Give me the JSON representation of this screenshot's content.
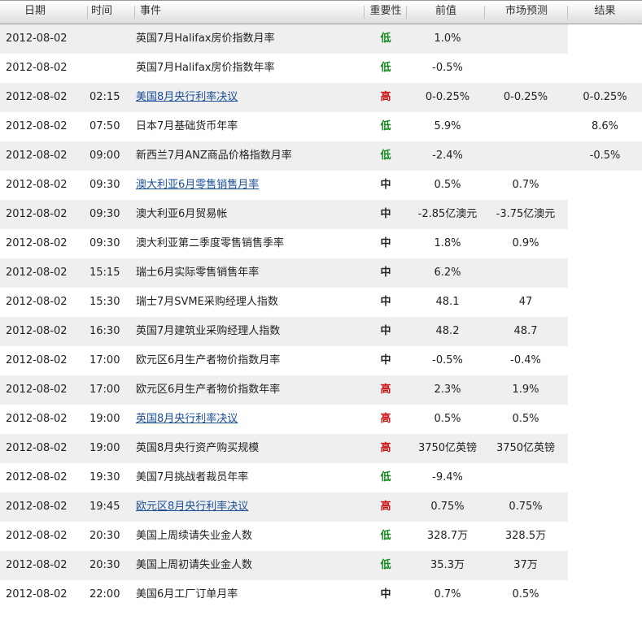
{
  "header": {
    "date": "日期",
    "time": "时间",
    "event": "事件",
    "importance": "重要性",
    "previous": "前值",
    "forecast": "市场预测",
    "result": "结果"
  },
  "colors": {
    "low": "#13881f",
    "medium": "#1a22b0",
    "high": "#d01010",
    "link": "#1a4f99"
  },
  "rows": [
    {
      "date": "2012-08-02",
      "time": "",
      "event": "英国7月Halifax房价指数月率",
      "link": false,
      "importance": "低",
      "level": "low",
      "previous": "1.0%",
      "forecast": "",
      "result": ""
    },
    {
      "date": "2012-08-02",
      "time": "",
      "event": "英国7月Halifax房价指数年率",
      "link": false,
      "importance": "低",
      "level": "low",
      "previous": "-0.5%",
      "forecast": "",
      "result": ""
    },
    {
      "date": "2012-08-02",
      "time": "02:15",
      "event": "美国8月央行利率决议",
      "link": true,
      "importance": "高",
      "level": "high",
      "previous": "0-0.25%",
      "forecast": "0-0.25%",
      "result": "0-0.25%"
    },
    {
      "date": "2012-08-02",
      "time": "07:50",
      "event": "日本7月基础货币年率",
      "link": false,
      "importance": "低",
      "level": "low",
      "previous": "5.9%",
      "forecast": "",
      "result": "8.6%"
    },
    {
      "date": "2012-08-02",
      "time": "09:00",
      "event": "新西兰7月ANZ商品价格指数月率",
      "link": false,
      "importance": "低",
      "level": "low",
      "previous": "-2.4%",
      "forecast": "",
      "result": "-0.5%"
    },
    {
      "date": "2012-08-02",
      "time": "09:30",
      "event": "澳大利亚6月零售销售月率",
      "link": true,
      "importance": "中",
      "level": "medium",
      "previous": "0.5%",
      "forecast": "0.7%",
      "result": ""
    },
    {
      "date": "2012-08-02",
      "time": "09:30",
      "event": "澳大利亚6月贸易帐",
      "link": false,
      "importance": "中",
      "level": "medium",
      "previous": "-2.85亿澳元",
      "forecast": "-3.75亿澳元",
      "result": ""
    },
    {
      "date": "2012-08-02",
      "time": "09:30",
      "event": "澳大利亚第二季度零售销售季率",
      "link": false,
      "importance": "中",
      "level": "medium",
      "previous": "1.8%",
      "forecast": "0.9%",
      "result": ""
    },
    {
      "date": "2012-08-02",
      "time": "15:15",
      "event": "瑞士6月实际零售销售年率",
      "link": false,
      "importance": "中",
      "level": "medium",
      "previous": "6.2%",
      "forecast": "",
      "result": ""
    },
    {
      "date": "2012-08-02",
      "time": "15:30",
      "event": "瑞士7月SVME采购经理人指数",
      "link": false,
      "importance": "中",
      "level": "medium",
      "previous": "48.1",
      "forecast": "47",
      "result": ""
    },
    {
      "date": "2012-08-02",
      "time": "16:30",
      "event": "英国7月建筑业采购经理人指数",
      "link": false,
      "importance": "中",
      "level": "medium",
      "previous": "48.2",
      "forecast": "48.7",
      "result": ""
    },
    {
      "date": "2012-08-02",
      "time": "17:00",
      "event": "欧元区6月生产者物价指数月率",
      "link": false,
      "importance": "中",
      "level": "medium",
      "previous": "-0.5%",
      "forecast": "-0.4%",
      "result": ""
    },
    {
      "date": "2012-08-02",
      "time": "17:00",
      "event": "欧元区6月生产者物价指数年率",
      "link": false,
      "importance": "高",
      "level": "high",
      "previous": "2.3%",
      "forecast": "1.9%",
      "result": ""
    },
    {
      "date": "2012-08-02",
      "time": "19:00",
      "event": "英国8月央行利率决议",
      "link": true,
      "importance": "高",
      "level": "high",
      "previous": "0.5%",
      "forecast": "0.5%",
      "result": ""
    },
    {
      "date": "2012-08-02",
      "time": "19:00",
      "event": "英国8月央行资产购买规模",
      "link": false,
      "importance": "高",
      "level": "high",
      "previous": "3750亿英镑",
      "forecast": "3750亿英镑",
      "result": ""
    },
    {
      "date": "2012-08-02",
      "time": "19:30",
      "event": "美国7月挑战者裁员年率",
      "link": false,
      "importance": "低",
      "level": "low",
      "previous": "-9.4%",
      "forecast": "",
      "result": ""
    },
    {
      "date": "2012-08-02",
      "time": "19:45",
      "event": "欧元区8月央行利率决议",
      "link": true,
      "importance": "高",
      "level": "high",
      "previous": "0.75%",
      "forecast": "0.75%",
      "result": ""
    },
    {
      "date": "2012-08-02",
      "time": "20:30",
      "event": "美国上周续请失业金人数",
      "link": false,
      "importance": "低",
      "level": "low",
      "previous": "328.7万",
      "forecast": "328.5万",
      "result": ""
    },
    {
      "date": "2012-08-02",
      "time": "20:30",
      "event": "美国上周初请失业金人数",
      "link": false,
      "importance": "低",
      "level": "low",
      "previous": "35.3万",
      "forecast": "37万",
      "result": ""
    },
    {
      "date": "2012-08-02",
      "time": "22:00",
      "event": "美国6月工厂订单月率",
      "link": false,
      "importance": "中",
      "level": "medium",
      "previous": "0.7%",
      "forecast": "0.5%",
      "result": ""
    }
  ]
}
